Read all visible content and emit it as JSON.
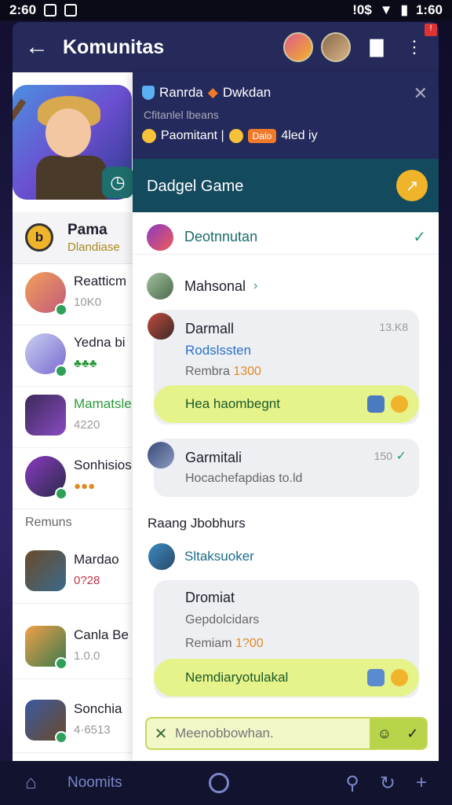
{
  "status_bar": {
    "time": "2:60",
    "right_time": "1:60",
    "signal_text": "!0$"
  },
  "app_bar": {
    "title": "Komunitas",
    "back_icon": "arrow-left-icon",
    "badge": "!"
  },
  "left_panel": {
    "header": {
      "name": "Pama",
      "sub": "Dlandiase"
    },
    "section_label": "Remuns",
    "items_top": [
      {
        "name": "Reatticm",
        "meta": "10K0"
      },
      {
        "name": "Yedna bi",
        "meta": "♣♣♣"
      },
      {
        "name": "Mamatsle",
        "meta": "4220"
      },
      {
        "name": "Sonhisios",
        "meta": "●●●"
      }
    ],
    "items_bottom": [
      {
        "name": "Mardao",
        "meta": "0?28"
      },
      {
        "name": "Canla Be",
        "meta": "1.0.0"
      },
      {
        "name": "Sonchia",
        "meta": "4·6513"
      }
    ]
  },
  "right_panel": {
    "top": {
      "line1a": "Ranrda",
      "line1b": "Dwkdan",
      "line2": "Cfitanlel lbeans",
      "line3a": "Paomitant |",
      "badge": "Dalo",
      "line3b": "4led iy"
    },
    "band": {
      "title": "Dadgel Game"
    },
    "rows": {
      "r1": "Deotnnutan",
      "r2": "Mahsonal"
    },
    "msg1": {
      "name": "Darmall",
      "time": "13.K8",
      "link": "Rodslssten",
      "meta_label": "Rembra",
      "meta_value": "1300",
      "highlight": "Hea haombegnt"
    },
    "msg2": {
      "name": "Garmitali",
      "time": "150",
      "text": "Hocachefapdias to.ld"
    },
    "section": "Raang Jbobhurs",
    "r3": "Sltaksuoker",
    "msg3": {
      "name": "Dromiat",
      "sub": "Gepdolcidars",
      "meta_label": "Remiam",
      "meta_value": "1?00",
      "highlight": "Nemdiaryotulakal"
    },
    "composer": {
      "placeholder": "Meenobbowhan."
    }
  },
  "bottom_nav": {
    "label": "Noomits"
  },
  "colors": {
    "accent_band": "#134a5e",
    "appbar": "#262a5a",
    "highlight": "#e6f28a"
  }
}
